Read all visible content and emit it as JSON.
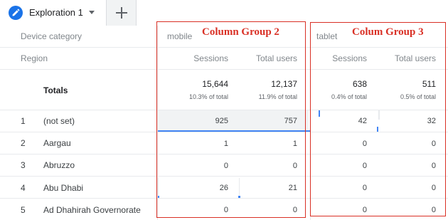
{
  "tabs": {
    "active_label": "Exploration 1"
  },
  "header": {
    "row1_label": "Device category",
    "row2_label": "Region"
  },
  "groups": [
    {
      "dimension_value": "mobile",
      "annotation": "Column Group 2",
      "metrics": [
        "Sessions",
        "Total users"
      ],
      "totals": [
        {
          "value": "15,644",
          "pct": "10.3% of total"
        },
        {
          "value": "12,137",
          "pct": "11.9% of total"
        }
      ]
    },
    {
      "dimension_value": "tablet",
      "annotation": "Colum Group 3",
      "metrics": [
        "Sessions",
        "Total users"
      ],
      "totals": [
        {
          "value": "638",
          "pct": "0.4% of total"
        },
        {
          "value": "511",
          "pct": "0.5% of total"
        }
      ]
    }
  ],
  "totals_label": "Totals",
  "rows": [
    {
      "index": "1",
      "region": "(not set)",
      "mobile_sessions": "925",
      "mobile_users": "757",
      "tablet_sessions": "42",
      "tablet_users": "32"
    },
    {
      "index": "2",
      "region": "Aargau",
      "mobile_sessions": "1",
      "mobile_users": "1",
      "tablet_sessions": "0",
      "tablet_users": "0"
    },
    {
      "index": "3",
      "region": "Abruzzo",
      "mobile_sessions": "0",
      "mobile_users": "0",
      "tablet_sessions": "0",
      "tablet_users": "0"
    },
    {
      "index": "4",
      "region": "Abu Dhabi",
      "mobile_sessions": "26",
      "mobile_users": "21",
      "tablet_sessions": "0",
      "tablet_users": "0"
    },
    {
      "index": "5",
      "region": "Ad Dhahirah Governorate",
      "mobile_sessions": "0",
      "mobile_users": "0",
      "tablet_sessions": "0",
      "tablet_users": "0"
    }
  ],
  "colors": {
    "accent_blue": "#1a73e8",
    "annotation_red": "#d93025",
    "bar_blue": "#4285f4"
  },
  "icons": [
    "pencil-icon",
    "chevron-down-icon",
    "plus-icon"
  ]
}
